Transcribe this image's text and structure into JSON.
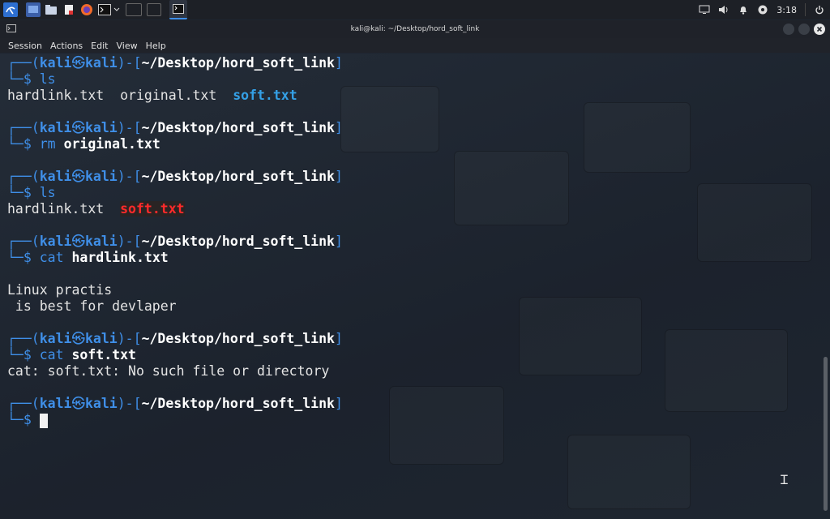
{
  "taskbar": {
    "launchers": [
      "kali-menu-icon",
      "desktop-icon",
      "files-icon",
      "text-editor-icon",
      "firefox-icon",
      "terminal-icon"
    ],
    "clock": "3:18"
  },
  "window": {
    "title": "kali@kali: ~/Desktop/hord_soft_link",
    "menu": [
      "Session",
      "Actions",
      "Edit",
      "View",
      "Help"
    ]
  },
  "colors": {
    "prompt": "#3f8fe8",
    "dir_listing": "#34a0e6",
    "broken_link": "#ff2a2a"
  },
  "prompt": {
    "top_prefix": "┌──(",
    "user": "kali",
    "at": "㉿",
    "host": "kali",
    "mid": ")-[",
    "path": "~/Desktop/hord_soft_link",
    "end": "]",
    "bottom_prefix": "└─$ "
  },
  "blocks": [
    {
      "command": "ls",
      "cmd_name": "ls",
      "cmd_arg": "",
      "output": [
        "hardlink.txt",
        "original.txt",
        "soft.txt"
      ]
    },
    {
      "command": "rm original.txt",
      "cmd_name": "rm",
      "cmd_arg": "original.txt"
    },
    {
      "command": "ls",
      "cmd_name": "ls",
      "cmd_arg": "",
      "output": [
        "hardlink.txt",
        "soft.txt"
      ]
    },
    {
      "command": "cat hardlink.txt",
      "cmd_name": "cat",
      "cmd_arg": "hardlink.txt",
      "output": [
        "Linux practis",
        " is best for devlaper"
      ]
    },
    {
      "command": "cat soft.txt",
      "cmd_name": "cat",
      "cmd_arg": "soft.txt",
      "output": [
        "cat: soft.txt: No such file or directory"
      ]
    }
  ]
}
